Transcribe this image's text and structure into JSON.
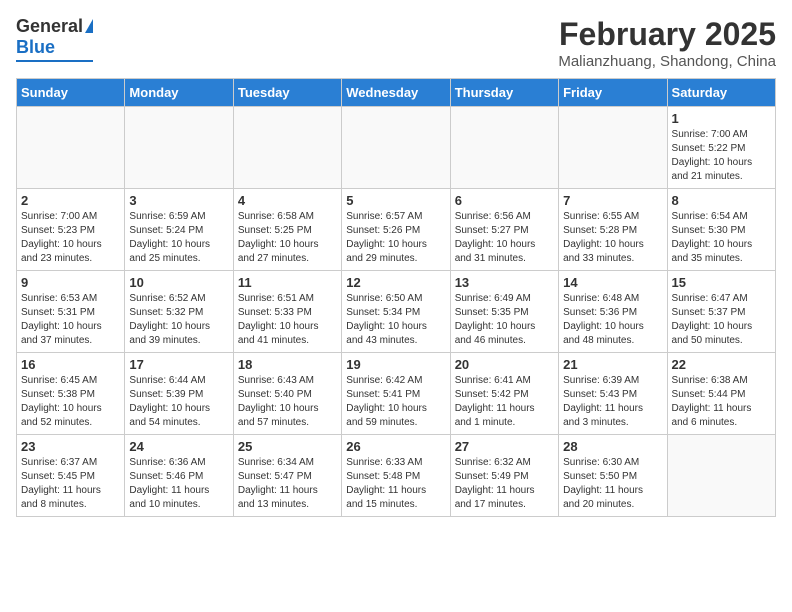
{
  "header": {
    "logo_general": "General",
    "logo_blue": "Blue",
    "main_title": "February 2025",
    "subtitle": "Malianzhuang, Shandong, China"
  },
  "calendar": {
    "weekdays": [
      "Sunday",
      "Monday",
      "Tuesday",
      "Wednesday",
      "Thursday",
      "Friday",
      "Saturday"
    ],
    "weeks": [
      [
        {
          "day": "",
          "info": ""
        },
        {
          "day": "",
          "info": ""
        },
        {
          "day": "",
          "info": ""
        },
        {
          "day": "",
          "info": ""
        },
        {
          "day": "",
          "info": ""
        },
        {
          "day": "",
          "info": ""
        },
        {
          "day": "1",
          "info": "Sunrise: 7:00 AM\nSunset: 5:22 PM\nDaylight: 10 hours\nand 21 minutes."
        }
      ],
      [
        {
          "day": "2",
          "info": "Sunrise: 7:00 AM\nSunset: 5:23 PM\nDaylight: 10 hours\nand 23 minutes."
        },
        {
          "day": "3",
          "info": "Sunrise: 6:59 AM\nSunset: 5:24 PM\nDaylight: 10 hours\nand 25 minutes."
        },
        {
          "day": "4",
          "info": "Sunrise: 6:58 AM\nSunset: 5:25 PM\nDaylight: 10 hours\nand 27 minutes."
        },
        {
          "day": "5",
          "info": "Sunrise: 6:57 AM\nSunset: 5:26 PM\nDaylight: 10 hours\nand 29 minutes."
        },
        {
          "day": "6",
          "info": "Sunrise: 6:56 AM\nSunset: 5:27 PM\nDaylight: 10 hours\nand 31 minutes."
        },
        {
          "day": "7",
          "info": "Sunrise: 6:55 AM\nSunset: 5:28 PM\nDaylight: 10 hours\nand 33 minutes."
        },
        {
          "day": "8",
          "info": "Sunrise: 6:54 AM\nSunset: 5:30 PM\nDaylight: 10 hours\nand 35 minutes."
        }
      ],
      [
        {
          "day": "9",
          "info": "Sunrise: 6:53 AM\nSunset: 5:31 PM\nDaylight: 10 hours\nand 37 minutes."
        },
        {
          "day": "10",
          "info": "Sunrise: 6:52 AM\nSunset: 5:32 PM\nDaylight: 10 hours\nand 39 minutes."
        },
        {
          "day": "11",
          "info": "Sunrise: 6:51 AM\nSunset: 5:33 PM\nDaylight: 10 hours\nand 41 minutes."
        },
        {
          "day": "12",
          "info": "Sunrise: 6:50 AM\nSunset: 5:34 PM\nDaylight: 10 hours\nand 43 minutes."
        },
        {
          "day": "13",
          "info": "Sunrise: 6:49 AM\nSunset: 5:35 PM\nDaylight: 10 hours\nand 46 minutes."
        },
        {
          "day": "14",
          "info": "Sunrise: 6:48 AM\nSunset: 5:36 PM\nDaylight: 10 hours\nand 48 minutes."
        },
        {
          "day": "15",
          "info": "Sunrise: 6:47 AM\nSunset: 5:37 PM\nDaylight: 10 hours\nand 50 minutes."
        }
      ],
      [
        {
          "day": "16",
          "info": "Sunrise: 6:45 AM\nSunset: 5:38 PM\nDaylight: 10 hours\nand 52 minutes."
        },
        {
          "day": "17",
          "info": "Sunrise: 6:44 AM\nSunset: 5:39 PM\nDaylight: 10 hours\nand 54 minutes."
        },
        {
          "day": "18",
          "info": "Sunrise: 6:43 AM\nSunset: 5:40 PM\nDaylight: 10 hours\nand 57 minutes."
        },
        {
          "day": "19",
          "info": "Sunrise: 6:42 AM\nSunset: 5:41 PM\nDaylight: 10 hours\nand 59 minutes."
        },
        {
          "day": "20",
          "info": "Sunrise: 6:41 AM\nSunset: 5:42 PM\nDaylight: 11 hours\nand 1 minute."
        },
        {
          "day": "21",
          "info": "Sunrise: 6:39 AM\nSunset: 5:43 PM\nDaylight: 11 hours\nand 3 minutes."
        },
        {
          "day": "22",
          "info": "Sunrise: 6:38 AM\nSunset: 5:44 PM\nDaylight: 11 hours\nand 6 minutes."
        }
      ],
      [
        {
          "day": "23",
          "info": "Sunrise: 6:37 AM\nSunset: 5:45 PM\nDaylight: 11 hours\nand 8 minutes."
        },
        {
          "day": "24",
          "info": "Sunrise: 6:36 AM\nSunset: 5:46 PM\nDaylight: 11 hours\nand 10 minutes."
        },
        {
          "day": "25",
          "info": "Sunrise: 6:34 AM\nSunset: 5:47 PM\nDaylight: 11 hours\nand 13 minutes."
        },
        {
          "day": "26",
          "info": "Sunrise: 6:33 AM\nSunset: 5:48 PM\nDaylight: 11 hours\nand 15 minutes."
        },
        {
          "day": "27",
          "info": "Sunrise: 6:32 AM\nSunset: 5:49 PM\nDaylight: 11 hours\nand 17 minutes."
        },
        {
          "day": "28",
          "info": "Sunrise: 6:30 AM\nSunset: 5:50 PM\nDaylight: 11 hours\nand 20 minutes."
        },
        {
          "day": "",
          "info": ""
        }
      ]
    ]
  }
}
